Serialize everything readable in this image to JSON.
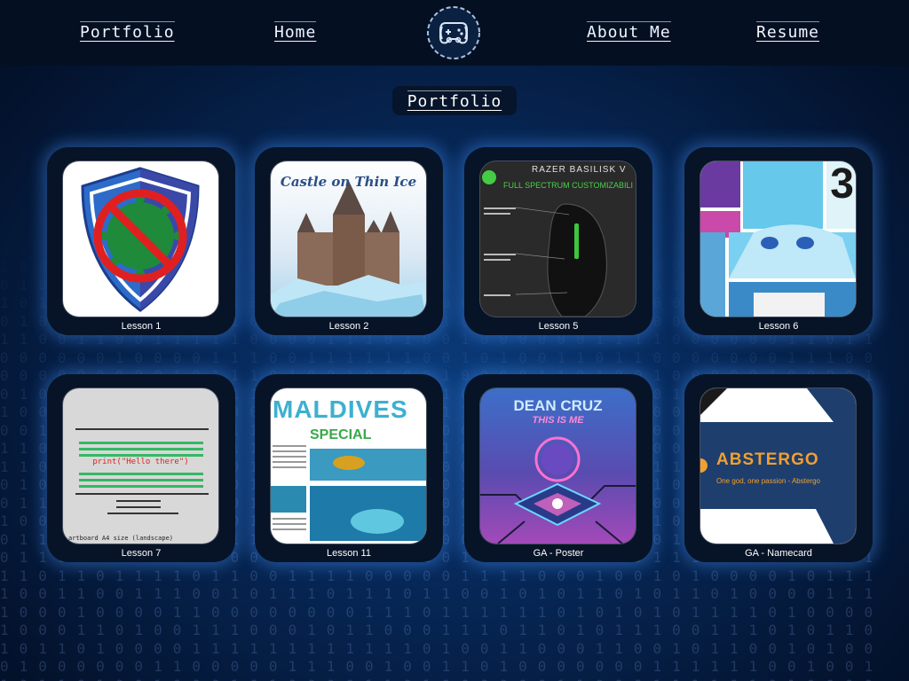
{
  "nav": {
    "portfolio": "Portfolio",
    "home": "Home",
    "about": "About Me",
    "resume": "Resume"
  },
  "page_title": "Portfolio",
  "cards": [
    {
      "label": "Lesson 1",
      "icon": "antivirus-shield-thumbnail"
    },
    {
      "label": "Lesson 2",
      "icon": "castle-on-ice-thumbnail",
      "text": "Castle on Thin Ice"
    },
    {
      "label": "Lesson 5",
      "icon": "razer-mouse-thumbnail",
      "text": "RAZER BASILISK V",
      "text2": "FULL SPECTRUM CUSTOMIZABILI"
    },
    {
      "label": "Lesson 6",
      "icon": "anime-comic-thumbnail",
      "text": "3"
    },
    {
      "label": "Lesson 7",
      "icon": "code-artboard-thumbnail",
      "text": "print(\"Hello there\")",
      "text2": "artboard A4 size (landscape)"
    },
    {
      "label": "Lesson 11",
      "icon": "maldives-magazine-thumbnail",
      "text": "MALDIVES",
      "text2": "SPECIAL"
    },
    {
      "label": "GA - Poster",
      "icon": "dean-cruz-poster-thumbnail",
      "text": "DEAN CRUZ",
      "text2": "THIS IS ME"
    },
    {
      "label": "GA - Namecard",
      "icon": "abstergo-namecard-thumbnail",
      "text": "ABSTERGO",
      "text2": "One god, one passion - Abstergo"
    }
  ],
  "colors": {
    "nav_bg": "#041022",
    "card_bg": "#071327",
    "glow": "#4696ff"
  }
}
